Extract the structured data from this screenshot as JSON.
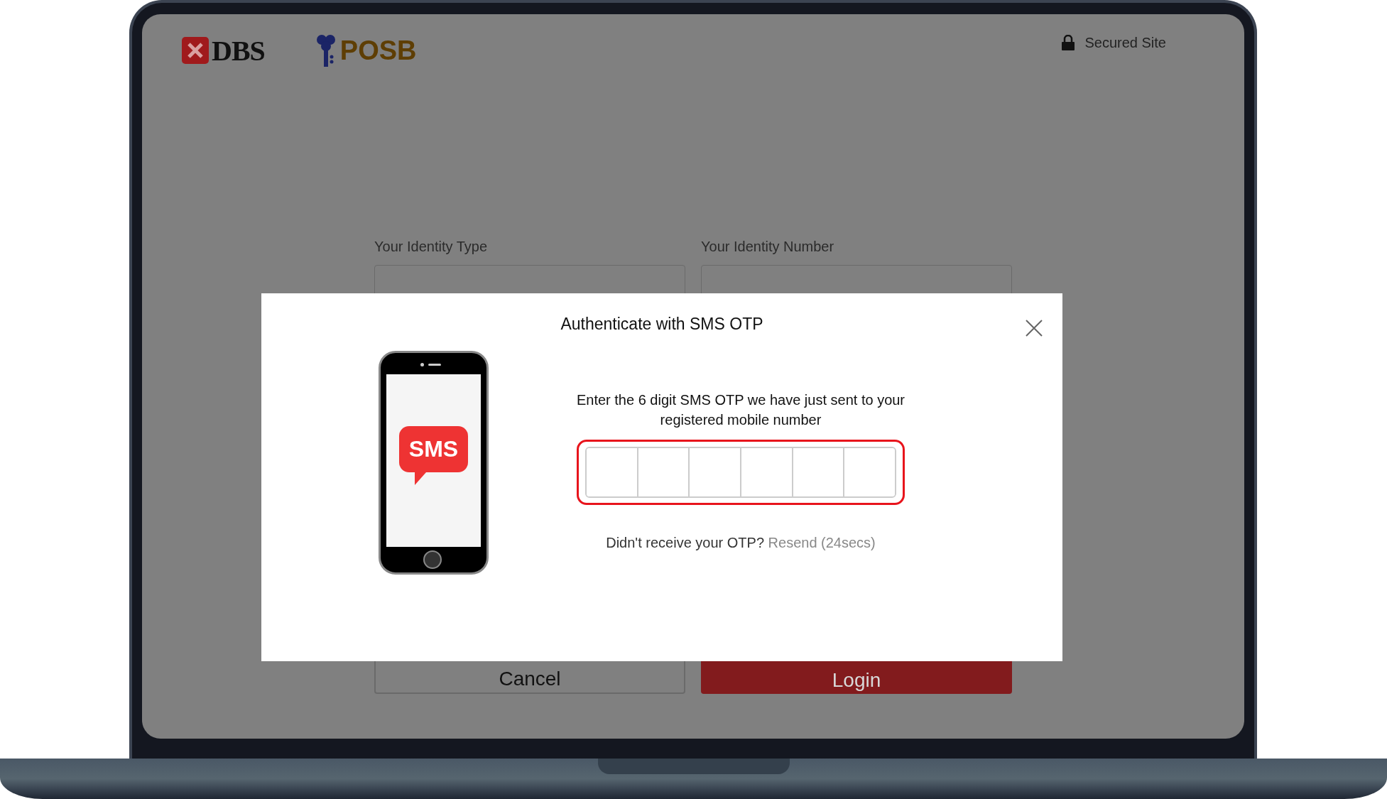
{
  "header": {
    "logos": [
      {
        "kind": "dbs",
        "text": "DBS"
      },
      {
        "kind": "posb",
        "text": "POSB"
      }
    ],
    "secured_label": "Secured Site"
  },
  "form": {
    "fields": [
      {
        "label": "Your Identity Type"
      },
      {
        "label": "Your Identity Number"
      }
    ],
    "buttons": [
      {
        "kind": "secondary",
        "label": "Cancel"
      },
      {
        "kind": "primary",
        "label": "Login"
      }
    ]
  },
  "dialog": {
    "title": "Authenticate with SMS OTP",
    "badge": "SMS",
    "instruction": "Enter the 6 digit SMS OTP we have just sent to your registered mobile number",
    "otp_cells": [
      {
        "kind": "digit"
      },
      {
        "kind": "digit"
      },
      {
        "kind": "digit"
      },
      {
        "kind": "digit"
      },
      {
        "kind": "digit"
      },
      {
        "kind": "digit"
      }
    ],
    "resend_prompt": "Didn't receive your OTP?",
    "resend_link": "Resend (24secs)"
  }
}
